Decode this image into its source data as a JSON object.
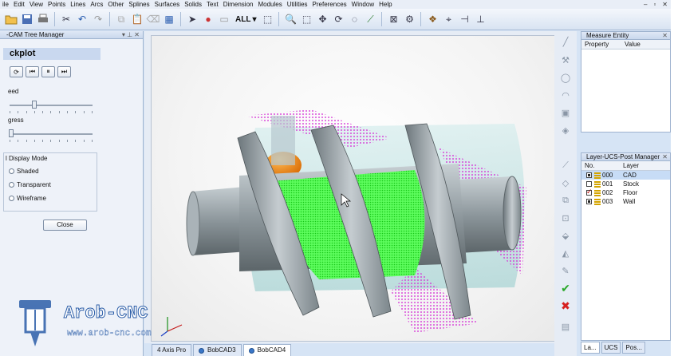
{
  "menu": [
    "ile",
    "Edit",
    "View",
    "Points",
    "Lines",
    "Arcs",
    "Other",
    "Splines",
    "Surfaces",
    "Solids",
    "Text",
    "Dimension",
    "Modules",
    "Utilities",
    "Preferences",
    "Window",
    "Help"
  ],
  "window_controls": [
    "–",
    "▫",
    "✕"
  ],
  "toolbar": {
    "selection_filter": "ALL"
  },
  "left_panel": {
    "title": "-CAM Tree Manager",
    "section": "ckplot",
    "speed_label": "eed",
    "speed_value": 0.3,
    "progress_label": "gress",
    "progress_value": 0.02,
    "display_mode_label": "l Display Mode",
    "modes": [
      "Shaded",
      "Transparent",
      "Wireframe"
    ],
    "close_label": "Close"
  },
  "measure_panel": {
    "title": "Measure Entity",
    "col_property": "Property",
    "col_value": "Value"
  },
  "layer_panel": {
    "title": "Layer-UCS-Post Manager",
    "col_no": "No.",
    "col_layer": "Layer",
    "rows": [
      {
        "no": "000",
        "name": "CAD",
        "selected": true
      },
      {
        "no": "001",
        "name": "Stock",
        "selected": false
      },
      {
        "no": "002",
        "name": "Floor",
        "selected": false
      },
      {
        "no": "003",
        "name": "Wall",
        "selected": false
      }
    ]
  },
  "right_tabs": [
    "La...",
    "UCS",
    "Pos..."
  ],
  "doc_tabs": [
    "4 Axis Pro",
    "BobCAD3",
    "BobCAD4"
  ],
  "watermark": {
    "brand": "Arob-CNC",
    "url": "www.arob-cnc.com"
  },
  "colors": {
    "toolpath_green": "#2fe52f",
    "toolpath_magenta": "#d62fd6",
    "part_gray": "#9aa3a8",
    "stock_cyan": "#bfe6e6",
    "accent_orange": "#f08a1c"
  }
}
